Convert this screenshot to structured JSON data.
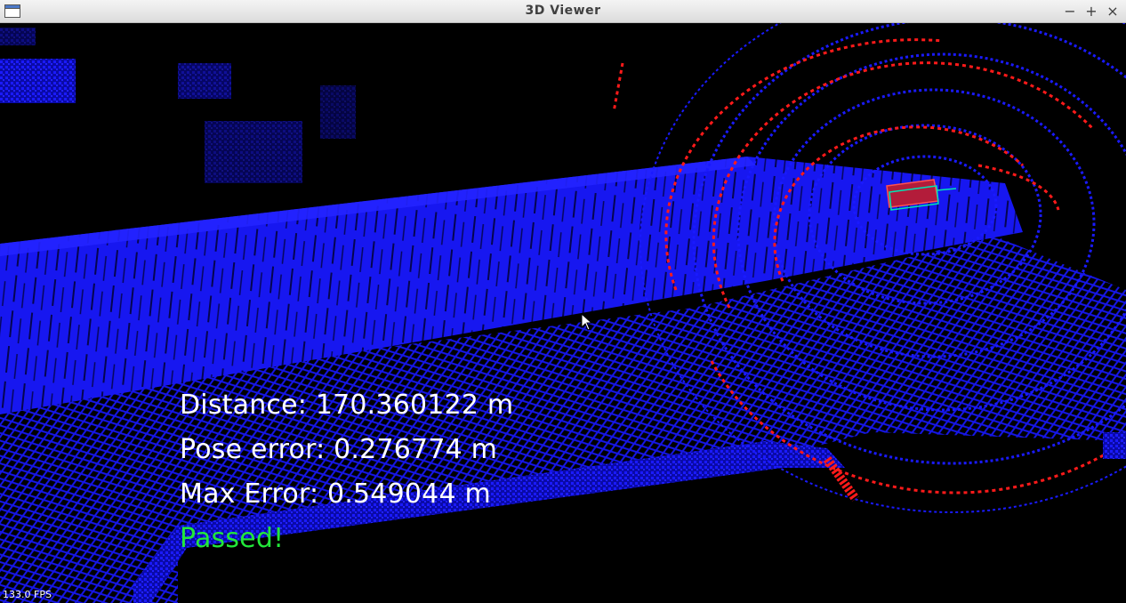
{
  "window": {
    "title": "3D Viewer",
    "controls": {
      "minimize": "−",
      "maximize": "+",
      "close": "×"
    }
  },
  "overlay": {
    "distance": "Distance: 170.360122 m",
    "pose_error": "Pose error: 0.276774 m",
    "max_error": "Max Error: 0.549044 m",
    "status": "Passed!"
  },
  "fps": "133.0 FPS",
  "colors": {
    "point_cloud": "#1414ff",
    "scan": "#ff1a1a",
    "status_pass": "#22e83a",
    "bounding_box": "#00e6b4"
  },
  "icons": [
    "window-icon",
    "minimize-icon",
    "maximize-icon",
    "close-icon",
    "mouse-cursor-icon"
  ]
}
